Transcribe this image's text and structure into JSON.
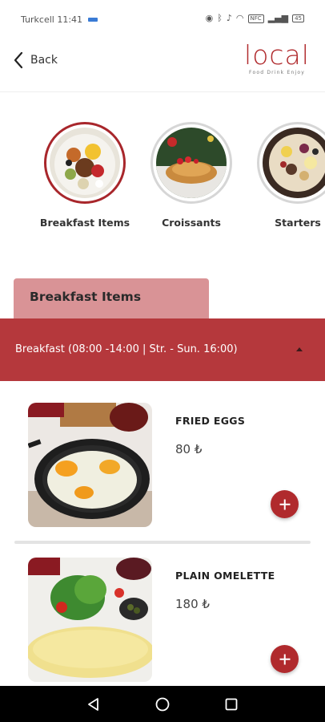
{
  "status_bar": {
    "carrier_time": "Turkcell 11:41",
    "nfc": "NFC",
    "battery": "45"
  },
  "header": {
    "back_label": "Back",
    "logo_text": "local",
    "logo_tagline": "Food Drink Enjoy"
  },
  "categories": [
    {
      "label": "Breakfast Items",
      "active": true
    },
    {
      "label": "Croissants",
      "active": false
    },
    {
      "label": "Starters",
      "active": false
    }
  ],
  "section": {
    "title": "Breakfast Items"
  },
  "accordion": {
    "title": "Breakfast (08:00 -14:00 | Str. - Sun. 16:00)",
    "expanded": true
  },
  "items": [
    {
      "name": "FRIED EGGS",
      "price": "80 ₺"
    },
    {
      "name": "PLAIN OMELETTE",
      "price": "180 ₺"
    }
  ],
  "colors": {
    "brand": "#b02a2d",
    "accordion": "#b5383c",
    "tab": "#d99396"
  }
}
